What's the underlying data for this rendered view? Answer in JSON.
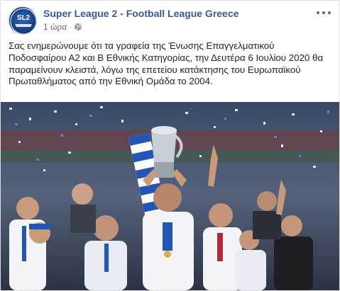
{
  "post": {
    "page_name": "Super League 2 - Football League Greece",
    "avatar_text": "SL2",
    "timestamp": "1 ώρα",
    "separator": "·",
    "privacy_icon": "globe-icon",
    "more_icon": "more-options-icon",
    "text": "Σας ενημερώνουμε ότι τα γραφεία της Ένωσης Επαγγελματικού Ποδοσφαίρου Α2 και Β Εθνικής Κατηγορίας, την Δευτέρα 6 Ιουλίου 2020 θα παραμείνουν κλειστά, λόγω της επετείου κατάκτησης του Ευρωπαϊκού Πρωταθλήματος από την Εθνική Ομάδα το 2004."
  },
  "colors": {
    "link": "#385898",
    "text": "#1d2129",
    "meta": "#616770",
    "border": "#dddfe2"
  }
}
